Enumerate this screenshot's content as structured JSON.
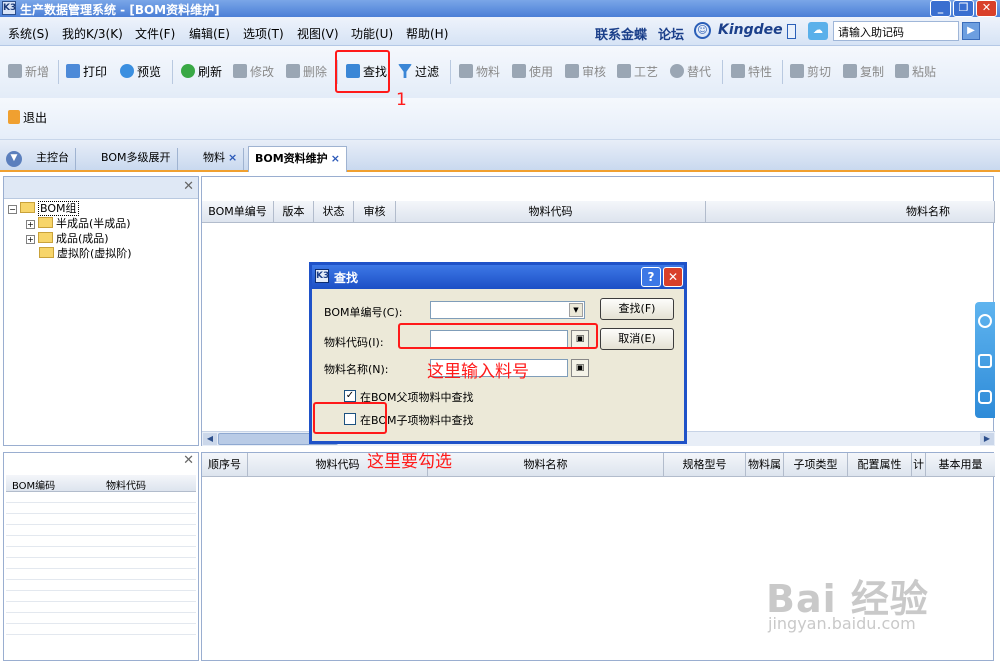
{
  "window": {
    "title": "生产数据管理系统 - [BOM资料维护]",
    "logo": "K3",
    "controls": [
      "_",
      "❐",
      "✕"
    ]
  },
  "menubar": {
    "items": [
      "系统(S)",
      "我的K/3(K)",
      "文件(F)",
      "编辑(E)",
      "选项(T)",
      "视图(V)",
      "功能(U)",
      "帮助(H)"
    ],
    "links": [
      "联系金蝶",
      "论坛"
    ],
    "brand": "Kingdee",
    "help_input": "请输入助记码"
  },
  "toolbar": {
    "buttons": [
      {
        "label": "新增",
        "icon": "plus-icon",
        "enabled": false
      },
      {
        "label": "打印",
        "icon": "printer-icon",
        "enabled": true
      },
      {
        "label": "预览",
        "icon": "preview-icon",
        "enabled": true
      },
      {
        "label": "刷新",
        "icon": "refresh-icon",
        "enabled": true
      },
      {
        "label": "修改",
        "icon": "edit-icon",
        "enabled": false
      },
      {
        "label": "删除",
        "icon": "trash-icon",
        "enabled": false
      },
      {
        "label": "查找",
        "icon": "find-icon",
        "enabled": true
      },
      {
        "label": "过滤",
        "icon": "filter-icon",
        "enabled": true
      },
      {
        "label": "物料",
        "icon": "material-icon",
        "enabled": false
      },
      {
        "label": "使用",
        "icon": "clipboard-icon",
        "enabled": false
      },
      {
        "label": "审核",
        "icon": "audit-icon",
        "enabled": false
      },
      {
        "label": "工艺",
        "icon": "tools-icon",
        "enabled": false
      },
      {
        "label": "替代",
        "icon": "replace-icon",
        "enabled": false
      },
      {
        "label": "特性",
        "icon": "feature-icon",
        "enabled": false
      },
      {
        "label": "剪切",
        "icon": "scissors-icon",
        "enabled": false
      },
      {
        "label": "复制",
        "icon": "copy-icon",
        "enabled": false
      },
      {
        "label": "粘贴",
        "icon": "paste-icon",
        "enabled": false
      }
    ],
    "exit_label": "退出"
  },
  "tabs": [
    {
      "label": "主控台",
      "closable": false,
      "active": false
    },
    {
      "label": "BOM多级展开",
      "closable": false,
      "active": false
    },
    {
      "label": "物料",
      "closable": true,
      "active": false
    },
    {
      "label": "BOM资料维护",
      "closable": true,
      "active": true
    }
  ],
  "tree": {
    "root": "BOM组",
    "children": [
      "半成品(半成品)",
      "成品(成品)",
      "虚拟阶(虚拟阶)"
    ]
  },
  "main_grid": {
    "columns": [
      "BOM单编号",
      "版本",
      "状态",
      "审核",
      "物料代码",
      "物料名称"
    ]
  },
  "bottom_left_grid": {
    "columns": [
      "BOM编码",
      "物料代码"
    ]
  },
  "detail_grid": {
    "columns": [
      "顺序号",
      "物料代码",
      "物料名称",
      "规格型号",
      "物料属性",
      "子项类型",
      "配置属性",
      "计划",
      "基本用量"
    ]
  },
  "dialog": {
    "title": "查找",
    "fields": {
      "bom_no_label": "BOM单编号(C):",
      "bom_no_value": "",
      "material_code_label": "物料代码(I):",
      "material_code_value": "",
      "material_name_label": "物料名称(N):",
      "material_name_value": ""
    },
    "checkboxes": [
      {
        "label": "在BOM父项物料中查找",
        "checked": true
      },
      {
        "label": "在BOM子项物料中查找",
        "checked": false
      }
    ],
    "buttons": {
      "find": "查找(F)",
      "cancel": "取消(E)"
    }
  },
  "annotations": {
    "step_number": "1",
    "input_hint": "这里输入料号",
    "check_hint": "这里要勾选"
  },
  "watermark": {
    "main": "Bai 经验",
    "url": "jingyan.baidu.com"
  },
  "colors": {
    "annotation_red": "#ff1a1a",
    "titlebar_blue": "#4b7fd6",
    "tab_accent": "#f0a030"
  }
}
